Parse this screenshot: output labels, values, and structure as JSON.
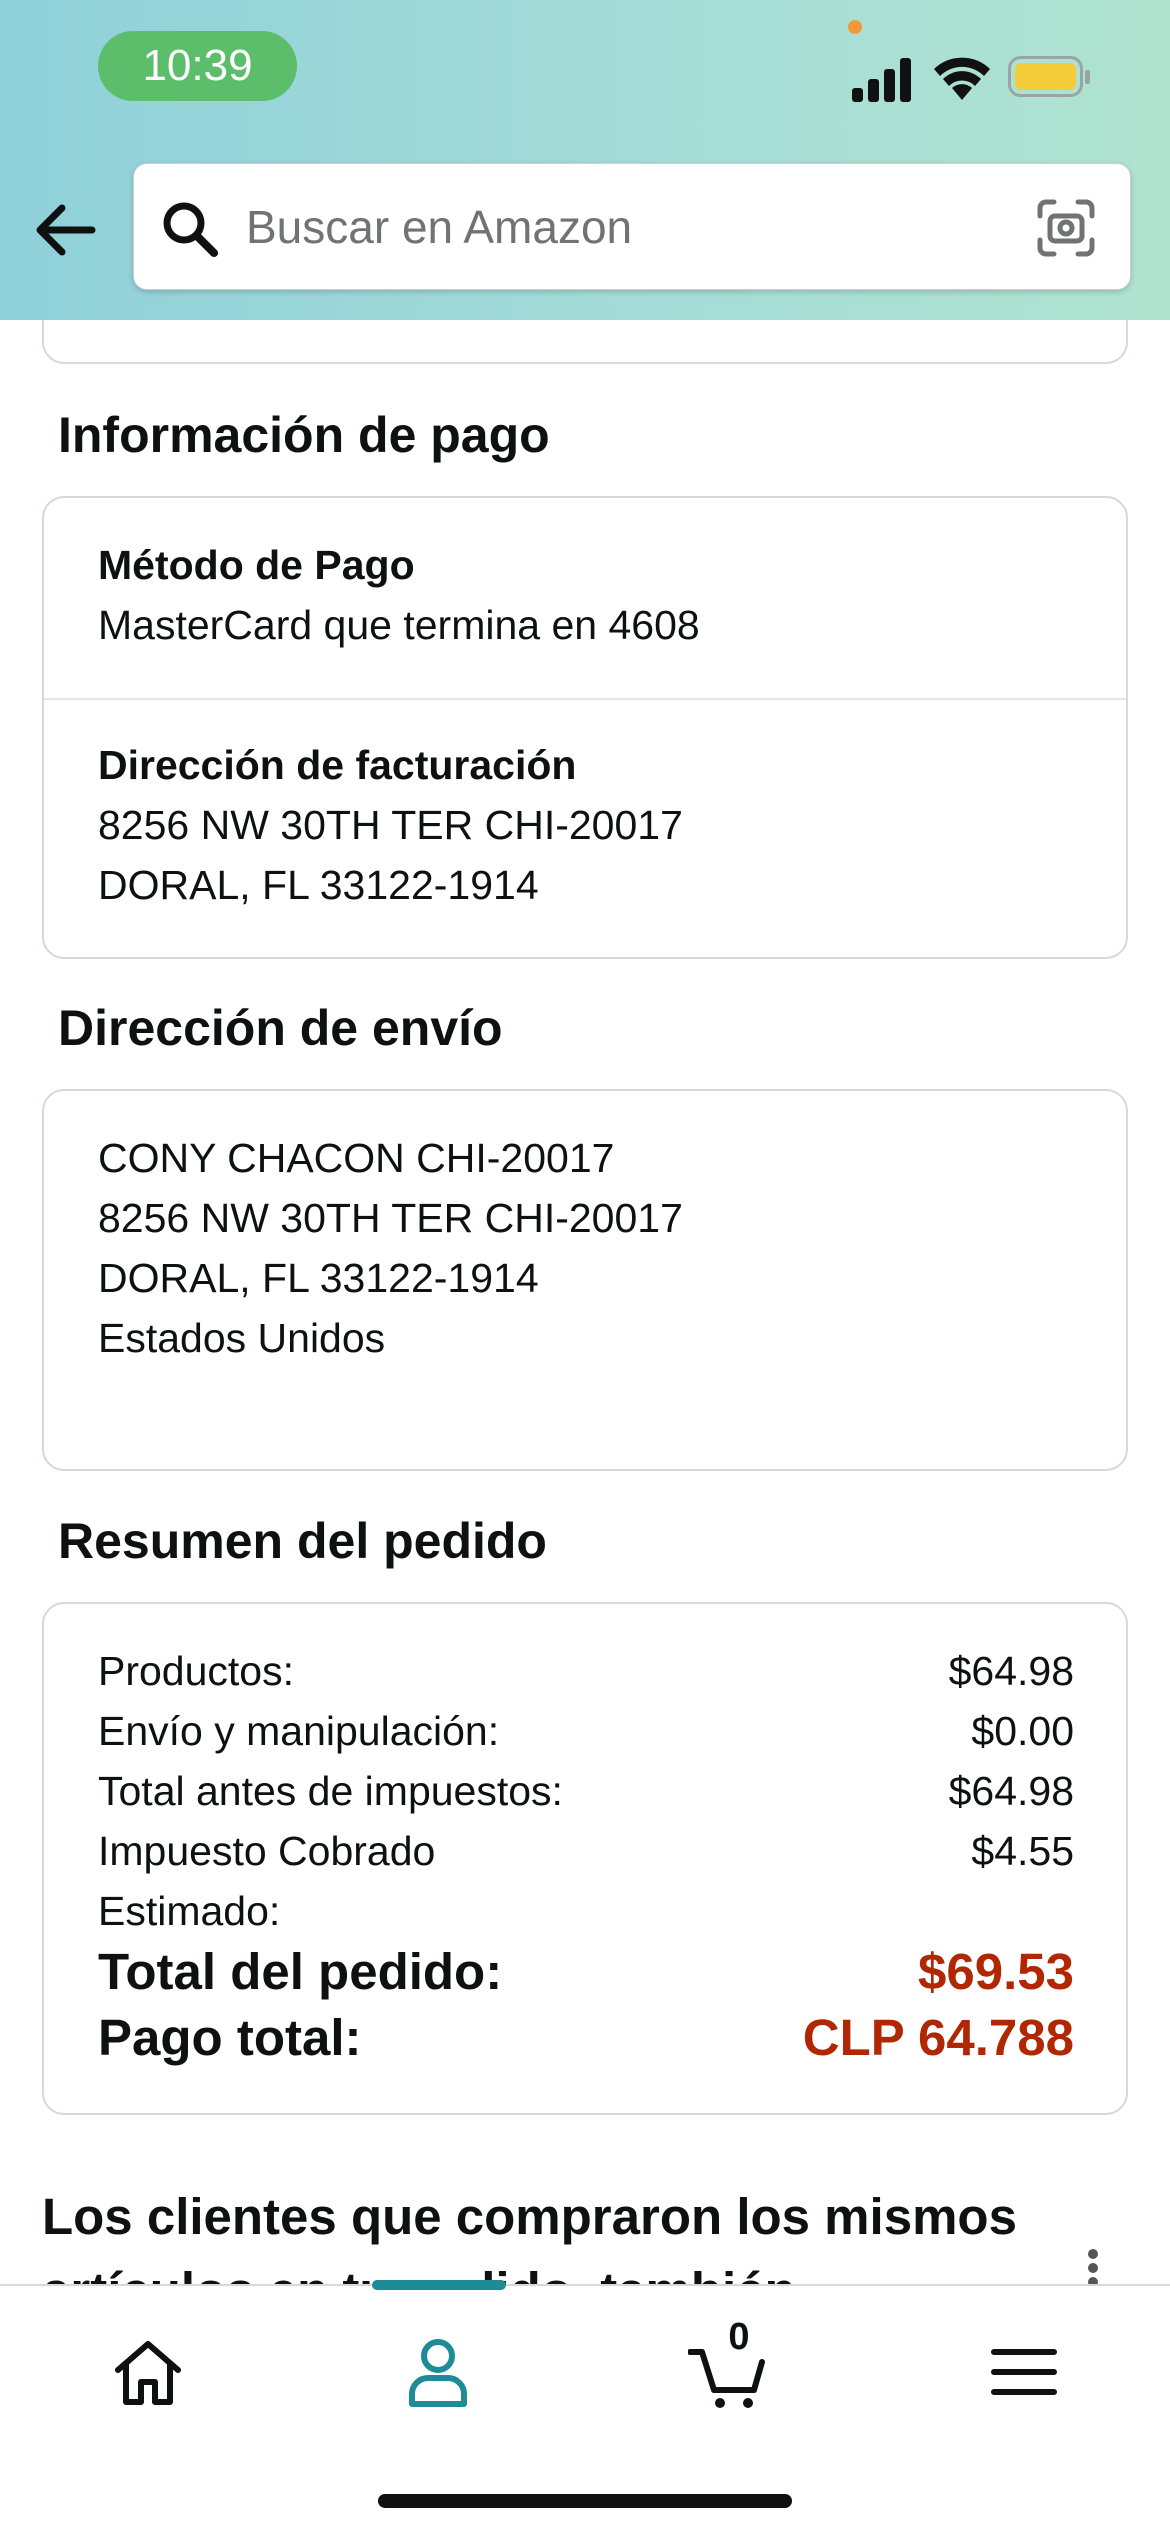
{
  "status_bar": {
    "time": "10:39"
  },
  "search": {
    "placeholder": "Buscar en Amazon"
  },
  "payment_info": {
    "title": "Información de pago",
    "method_label": "Método de Pago",
    "method_value": "MasterCard que termina en 4608",
    "billing_label": "Dirección de facturación",
    "billing_lines": [
      "8256 NW 30TH TER CHI-20017",
      "DORAL, FL 33122-1914"
    ]
  },
  "shipping": {
    "title": "Dirección de envío",
    "lines": [
      "CONY CHACON CHI-20017",
      "8256 NW 30TH TER CHI-20017",
      "DORAL, FL 33122-1914",
      "Estados Unidos"
    ]
  },
  "summary": {
    "title": "Resumen del pedido",
    "rows": [
      {
        "label": "Productos:",
        "value": "$64.98"
      },
      {
        "label": "Envío y manipulación:",
        "value": "$0.00"
      },
      {
        "label": "Total antes de impuestos:",
        "value": "$64.98"
      },
      {
        "label": "Impuesto Cobrado",
        "label2": "Estimado:",
        "value": "$4.55"
      }
    ],
    "order_total_label": "Total del pedido:",
    "order_total_value": "$69.53",
    "payment_total_label": "Pago total:",
    "payment_total_value": "CLP 64.788"
  },
  "recommendations": {
    "title": "Los clientes que compraron los mismos artículos en tu pedido, también"
  },
  "bottom_nav": {
    "items": [
      "home-icon",
      "account-icon",
      "cart-icon",
      "menu-icon"
    ],
    "cart_count": "0",
    "active_color": "#1f8b96"
  },
  "colors": {
    "price": "#b12704",
    "accent": "#1f8b96"
  }
}
